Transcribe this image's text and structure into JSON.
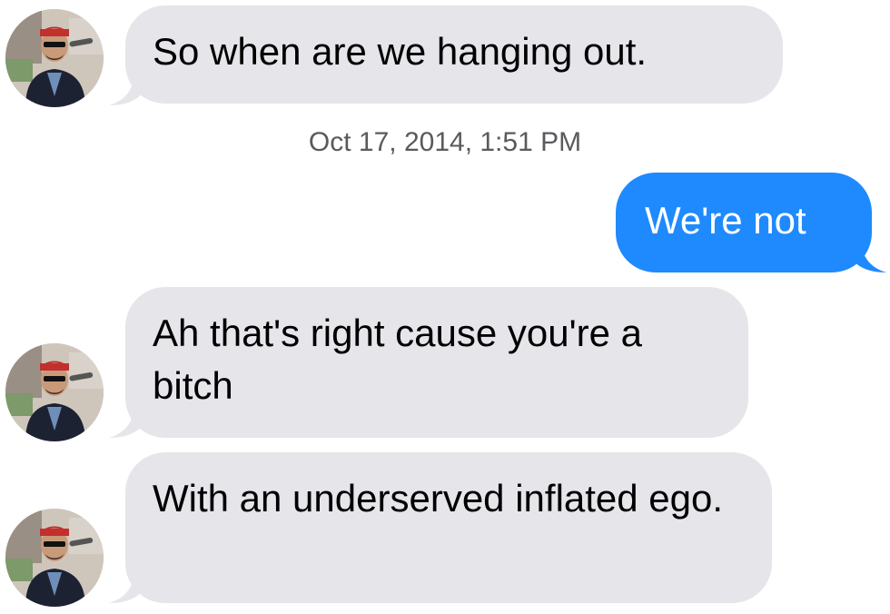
{
  "colors": {
    "incoming_bubble": "#e5e5ea",
    "outgoing_bubble": "#1f8afe",
    "outgoing_text": "#ffffff",
    "timestamp_text": "#5a5a5e"
  },
  "messages": [
    {
      "sender": "them",
      "text": "So when are we hanging out."
    },
    {
      "sender": "me",
      "text": "We're not"
    },
    {
      "sender": "them",
      "text": "Ah that's right cause you're a bitch"
    },
    {
      "sender": "them",
      "text": "With an underserved inflated ego."
    }
  ],
  "timestamp": "Oct 17, 2014, 1:51 PM",
  "avatar_icon": "contact-photo"
}
